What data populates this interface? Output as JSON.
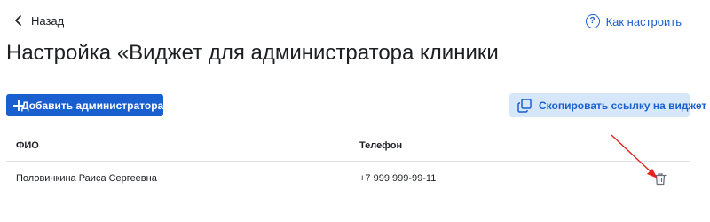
{
  "header": {
    "back_label": "Назад",
    "howto_label": "Как настроить"
  },
  "page": {
    "title": "Настройка «Виджет для администратора клиники"
  },
  "toolbar": {
    "add_admin_label": "Добавить администратора",
    "copy_link_label": "Скопировать ссылку на виджет"
  },
  "table": {
    "columns": [
      "ФИО",
      "Телефон"
    ],
    "rows": [
      {
        "name": "Половинкина Раиса Сергеевна",
        "phone": "+7 999 999-99-11"
      }
    ]
  },
  "icons": {
    "back": "chevron-left-icon",
    "help": "question-circle-icon",
    "add": "plus-icon",
    "copy": "copy-icon",
    "delete": "trash-icon",
    "annotation": "red-arrow"
  },
  "colors": {
    "accent": "#1a5fd0",
    "copy_button_bg": "#d7e7fa",
    "annotation_arrow": "#e8201f",
    "divider": "#dfe2e6"
  }
}
